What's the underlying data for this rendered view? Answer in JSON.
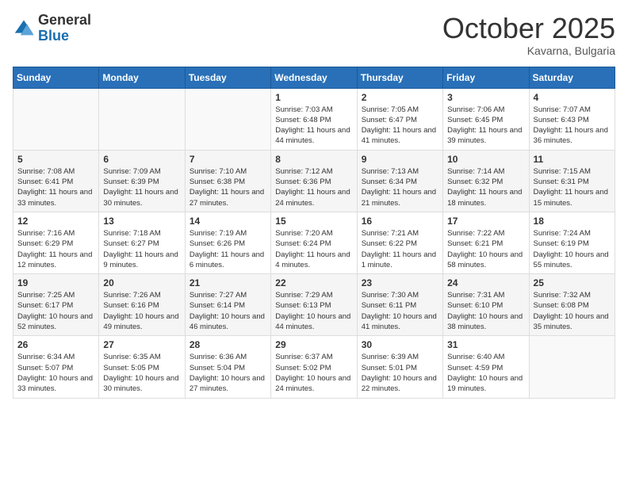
{
  "header": {
    "logo_line1": "General",
    "logo_line2": "Blue",
    "month": "October 2025",
    "location": "Kavarna, Bulgaria"
  },
  "days_of_week": [
    "Sunday",
    "Monday",
    "Tuesday",
    "Wednesday",
    "Thursday",
    "Friday",
    "Saturday"
  ],
  "weeks": [
    [
      {
        "day": "",
        "info": ""
      },
      {
        "day": "",
        "info": ""
      },
      {
        "day": "",
        "info": ""
      },
      {
        "day": "1",
        "info": "Sunrise: 7:03 AM\nSunset: 6:48 PM\nDaylight: 11 hours and 44 minutes."
      },
      {
        "day": "2",
        "info": "Sunrise: 7:05 AM\nSunset: 6:47 PM\nDaylight: 11 hours and 41 minutes."
      },
      {
        "day": "3",
        "info": "Sunrise: 7:06 AM\nSunset: 6:45 PM\nDaylight: 11 hours and 39 minutes."
      },
      {
        "day": "4",
        "info": "Sunrise: 7:07 AM\nSunset: 6:43 PM\nDaylight: 11 hours and 36 minutes."
      }
    ],
    [
      {
        "day": "5",
        "info": "Sunrise: 7:08 AM\nSunset: 6:41 PM\nDaylight: 11 hours and 33 minutes."
      },
      {
        "day": "6",
        "info": "Sunrise: 7:09 AM\nSunset: 6:39 PM\nDaylight: 11 hours and 30 minutes."
      },
      {
        "day": "7",
        "info": "Sunrise: 7:10 AM\nSunset: 6:38 PM\nDaylight: 11 hours and 27 minutes."
      },
      {
        "day": "8",
        "info": "Sunrise: 7:12 AM\nSunset: 6:36 PM\nDaylight: 11 hours and 24 minutes."
      },
      {
        "day": "9",
        "info": "Sunrise: 7:13 AM\nSunset: 6:34 PM\nDaylight: 11 hours and 21 minutes."
      },
      {
        "day": "10",
        "info": "Sunrise: 7:14 AM\nSunset: 6:32 PM\nDaylight: 11 hours and 18 minutes."
      },
      {
        "day": "11",
        "info": "Sunrise: 7:15 AM\nSunset: 6:31 PM\nDaylight: 11 hours and 15 minutes."
      }
    ],
    [
      {
        "day": "12",
        "info": "Sunrise: 7:16 AM\nSunset: 6:29 PM\nDaylight: 11 hours and 12 minutes."
      },
      {
        "day": "13",
        "info": "Sunrise: 7:18 AM\nSunset: 6:27 PM\nDaylight: 11 hours and 9 minutes."
      },
      {
        "day": "14",
        "info": "Sunrise: 7:19 AM\nSunset: 6:26 PM\nDaylight: 11 hours and 6 minutes."
      },
      {
        "day": "15",
        "info": "Sunrise: 7:20 AM\nSunset: 6:24 PM\nDaylight: 11 hours and 4 minutes."
      },
      {
        "day": "16",
        "info": "Sunrise: 7:21 AM\nSunset: 6:22 PM\nDaylight: 11 hours and 1 minute."
      },
      {
        "day": "17",
        "info": "Sunrise: 7:22 AM\nSunset: 6:21 PM\nDaylight: 10 hours and 58 minutes."
      },
      {
        "day": "18",
        "info": "Sunrise: 7:24 AM\nSunset: 6:19 PM\nDaylight: 10 hours and 55 minutes."
      }
    ],
    [
      {
        "day": "19",
        "info": "Sunrise: 7:25 AM\nSunset: 6:17 PM\nDaylight: 10 hours and 52 minutes."
      },
      {
        "day": "20",
        "info": "Sunrise: 7:26 AM\nSunset: 6:16 PM\nDaylight: 10 hours and 49 minutes."
      },
      {
        "day": "21",
        "info": "Sunrise: 7:27 AM\nSunset: 6:14 PM\nDaylight: 10 hours and 46 minutes."
      },
      {
        "day": "22",
        "info": "Sunrise: 7:29 AM\nSunset: 6:13 PM\nDaylight: 10 hours and 44 minutes."
      },
      {
        "day": "23",
        "info": "Sunrise: 7:30 AM\nSunset: 6:11 PM\nDaylight: 10 hours and 41 minutes."
      },
      {
        "day": "24",
        "info": "Sunrise: 7:31 AM\nSunset: 6:10 PM\nDaylight: 10 hours and 38 minutes."
      },
      {
        "day": "25",
        "info": "Sunrise: 7:32 AM\nSunset: 6:08 PM\nDaylight: 10 hours and 35 minutes."
      }
    ],
    [
      {
        "day": "26",
        "info": "Sunrise: 6:34 AM\nSunset: 5:07 PM\nDaylight: 10 hours and 33 minutes."
      },
      {
        "day": "27",
        "info": "Sunrise: 6:35 AM\nSunset: 5:05 PM\nDaylight: 10 hours and 30 minutes."
      },
      {
        "day": "28",
        "info": "Sunrise: 6:36 AM\nSunset: 5:04 PM\nDaylight: 10 hours and 27 minutes."
      },
      {
        "day": "29",
        "info": "Sunrise: 6:37 AM\nSunset: 5:02 PM\nDaylight: 10 hours and 24 minutes."
      },
      {
        "day": "30",
        "info": "Sunrise: 6:39 AM\nSunset: 5:01 PM\nDaylight: 10 hours and 22 minutes."
      },
      {
        "day": "31",
        "info": "Sunrise: 6:40 AM\nSunset: 4:59 PM\nDaylight: 10 hours and 19 minutes."
      },
      {
        "day": "",
        "info": ""
      }
    ]
  ]
}
